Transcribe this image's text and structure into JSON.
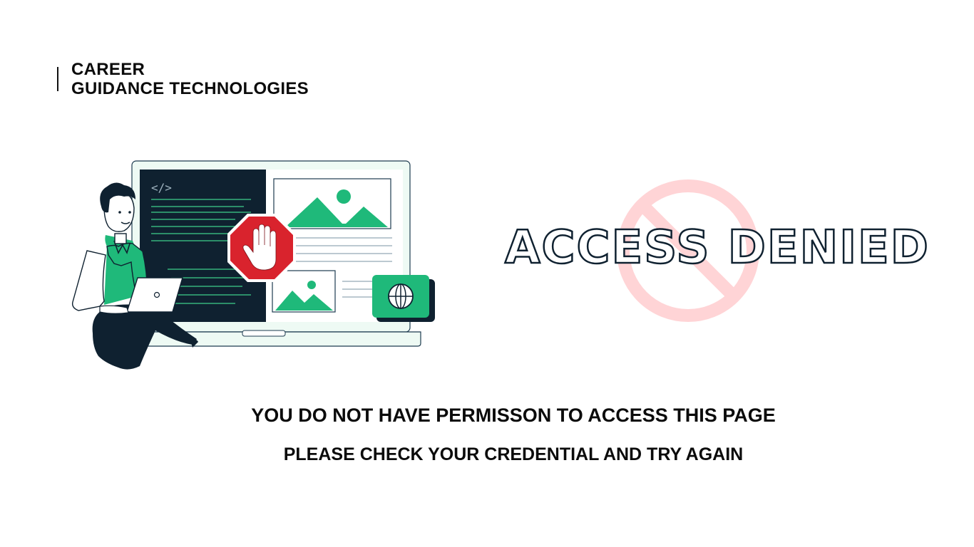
{
  "brand": {
    "line1": "CAREER",
    "line2": "GUIDANCE TECHNOLOGIES"
  },
  "illustration": {
    "code_tag": "</>",
    "icons": [
      "stop-hand-icon",
      "globe-icon",
      "image-icon",
      "person-icon",
      "laptop-icon"
    ]
  },
  "denied": {
    "title": "ACCESS DENIED",
    "icon": "prohibited-icon"
  },
  "messages": {
    "line1": "YOU DO NOT HAVE PERMISSON TO ACCESS THIS PAGE",
    "line2": "PLEASE CHECK YOUR CREDENTIAL AND TRY AGAIN"
  },
  "colors": {
    "accent_green": "#1fb97a",
    "dark_navy": "#0f2130",
    "stop_red": "#d9232d",
    "prohibit_pink": "#ffd4d6"
  }
}
